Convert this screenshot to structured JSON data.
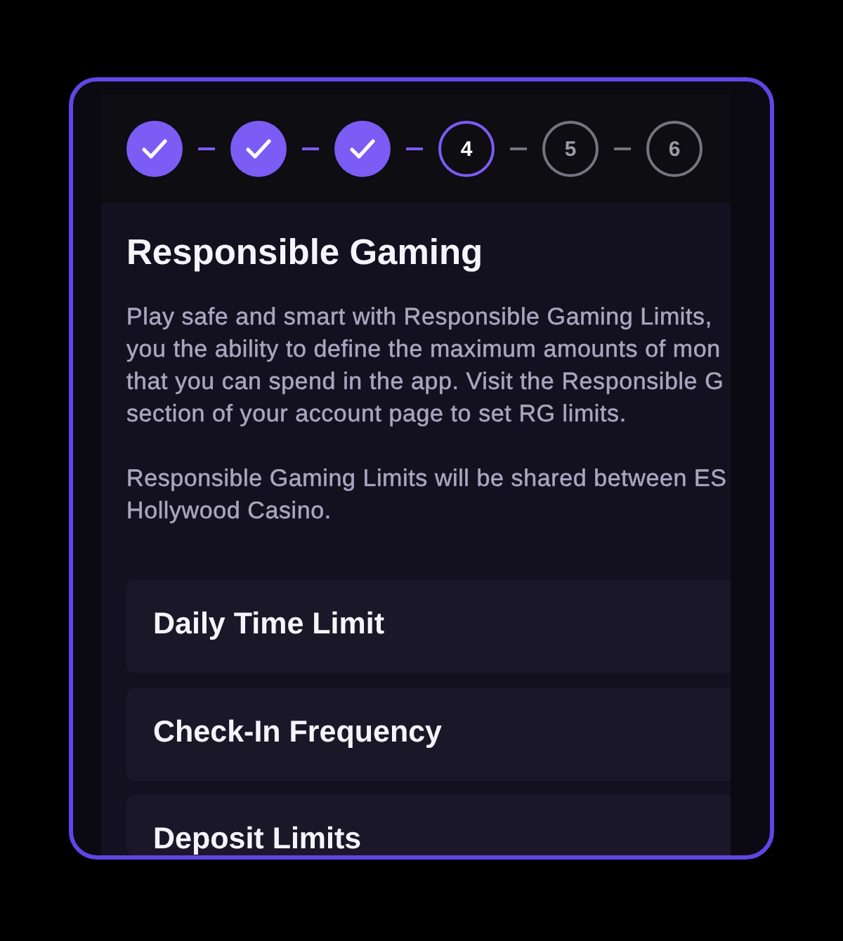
{
  "stepper": {
    "steps": [
      {
        "completed": true,
        "current": false
      },
      {
        "completed": true,
        "current": false
      },
      {
        "completed": true,
        "current": false
      },
      {
        "completed": false,
        "current": true,
        "number": "4"
      },
      {
        "completed": false,
        "current": false,
        "number": "5"
      },
      {
        "completed": false,
        "current": false,
        "number": "6"
      }
    ]
  },
  "section": {
    "title": "Responsible Gaming",
    "paragraphs": [
      "Play safe and smart with Responsible Gaming Limits,\nyou the ability to define the maximum amounts of mon\nthat you can spend in the app. Visit the Responsible G\nsection of your account page to set RG limits.",
      "Responsible Gaming Limits will be shared between ES\nHollywood Casino."
    ]
  },
  "options": [
    {
      "label": "Daily Time Limit"
    },
    {
      "label": "Check-In Frequency"
    },
    {
      "label": "Deposit Limits"
    }
  ]
}
